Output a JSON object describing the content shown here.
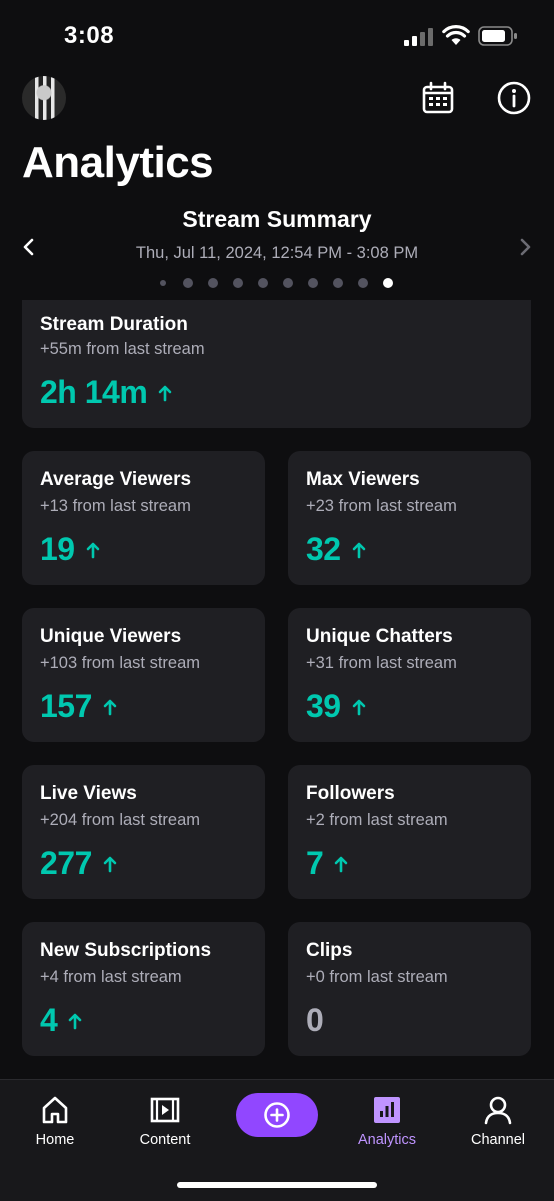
{
  "status_bar": {
    "time": "3:08"
  },
  "header": {
    "title": "Analytics"
  },
  "summary": {
    "title": "Stream Summary",
    "date": "Thu, Jul 11, 2024, 12:54 PM - 3:08 PM",
    "page_count": 10,
    "active_index": 9
  },
  "cards": {
    "stream_duration": {
      "title": "Stream Duration",
      "sub": "+55m from last stream",
      "value": "2h 14m"
    },
    "average_viewers": {
      "title": "Average Viewers",
      "sub": "+13 from last stream",
      "value": "19"
    },
    "max_viewers": {
      "title": "Max Viewers",
      "sub": "+23 from last stream",
      "value": "32"
    },
    "unique_viewers": {
      "title": "Unique Viewers",
      "sub": "+103 from last stream",
      "value": "157"
    },
    "unique_chatters": {
      "title": "Unique Chatters",
      "sub": "+31 from last stream",
      "value": "39"
    },
    "live_views": {
      "title": "Live Views",
      "sub": "+204 from last stream",
      "value": "277"
    },
    "followers": {
      "title": "Followers",
      "sub": "+2 from last stream",
      "value": "7"
    },
    "new_subscriptions": {
      "title": "New Subscriptions",
      "sub": "+4 from last stream",
      "value": "4"
    },
    "clips": {
      "title": "Clips",
      "sub": "+0 from last stream",
      "value": "0"
    }
  },
  "bottom_nav": {
    "home": "Home",
    "content": "Content",
    "analytics": "Analytics",
    "channel": "Channel"
  },
  "colors": {
    "accent": "#9147ff",
    "accent_light": "#bf94ff",
    "positive": "#00c8af",
    "background": "#0e0e10",
    "card": "#1f1f23"
  },
  "icons": [
    "signal-icon",
    "wifi-icon",
    "battery-icon",
    "calendar-icon",
    "info-icon",
    "chevron-left-icon",
    "chevron-right-icon",
    "arrow-up-icon",
    "home-icon",
    "content-icon",
    "plus-circle-icon",
    "analytics-icon",
    "channel-icon"
  ]
}
